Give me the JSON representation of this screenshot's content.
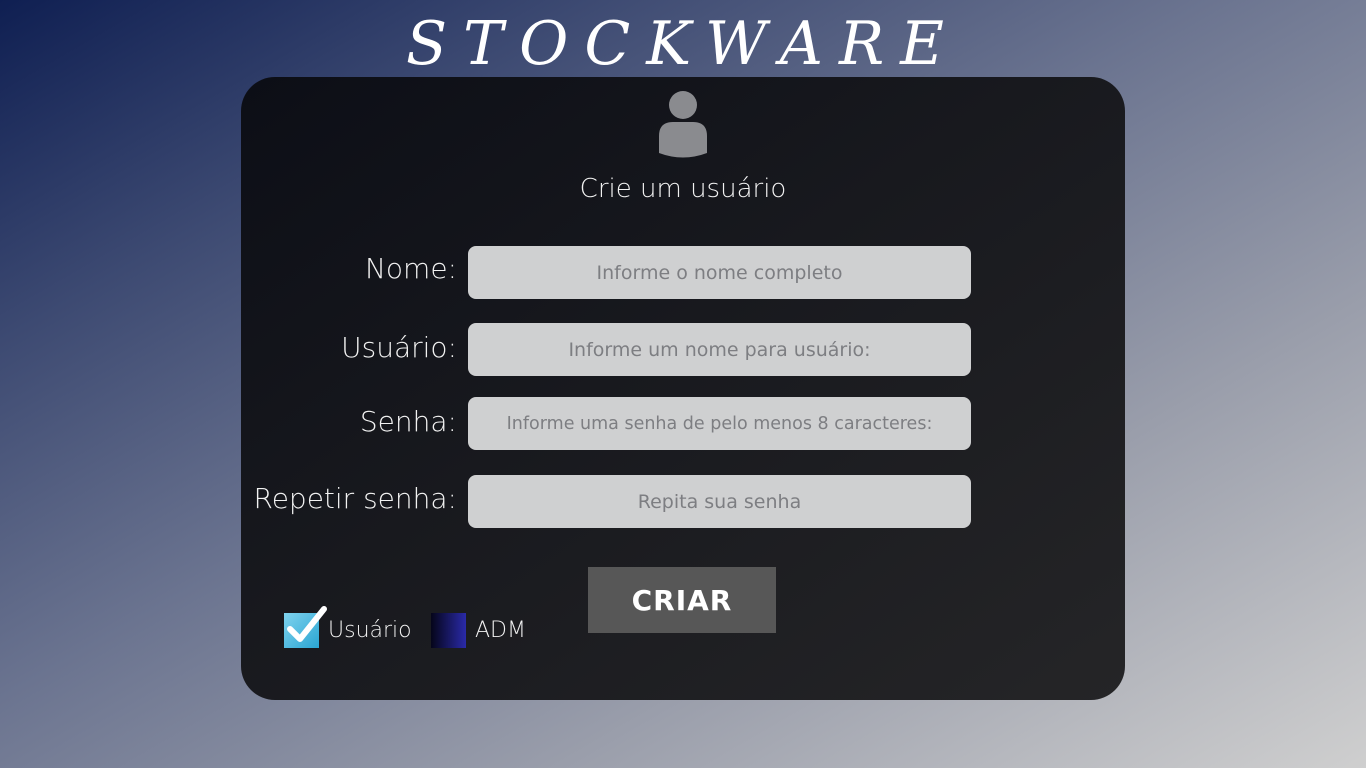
{
  "app": {
    "brand": "STOCKWARE"
  },
  "card": {
    "title": "Crie um usuário",
    "avatar_icon": "user-silhouette-icon"
  },
  "form": {
    "fields": [
      {
        "label": "Nome:",
        "placeholder": "Informe o nome completo",
        "value": ""
      },
      {
        "label": "Usuário:",
        "placeholder": "Informe um nome para usuário:",
        "value": ""
      },
      {
        "label": "Senha:",
        "placeholder": "Informe uma senha de pelo menos 8 caracteres:",
        "value": ""
      },
      {
        "label": "Repetir senha:",
        "placeholder": "Repita sua senha",
        "value": ""
      }
    ],
    "submit_label": "CRIAR"
  },
  "role_options": [
    {
      "label": "Usuário",
      "checked": true
    },
    {
      "label": "ADM",
      "checked": false
    }
  ],
  "colors": {
    "card_bg": "#15161b",
    "field_bg": "#cfd0d1",
    "button_bg": "#575757",
    "check_accent": "#2aa5d3",
    "adm_box": "#2a2aa8"
  }
}
